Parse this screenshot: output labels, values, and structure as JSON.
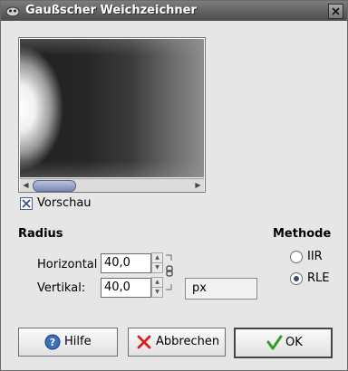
{
  "window": {
    "title": "Gaußscher Weichzeichner"
  },
  "preview": {
    "checkbox_label": "Vorschau",
    "checked": true
  },
  "radius": {
    "heading": "Radius",
    "horizontal_label": "Horizontal",
    "horizontal_value": "40,0",
    "vertical_label": "Vertikal:",
    "vertical_value": "40,0",
    "unit": "px"
  },
  "method": {
    "heading": "Methode",
    "options": [
      {
        "label": "IIR",
        "selected": false
      },
      {
        "label": "RLE",
        "selected": true
      }
    ]
  },
  "buttons": {
    "help": "Hilfe",
    "cancel": "Abbrechen",
    "ok": "OK"
  },
  "colors": {
    "title_bar": "#5a5a5a",
    "window_bg": "#e6e6e6",
    "ok_icon": "#2ea02e",
    "cancel_icon": "#d42020",
    "help_icon": "#3b6fb6"
  }
}
